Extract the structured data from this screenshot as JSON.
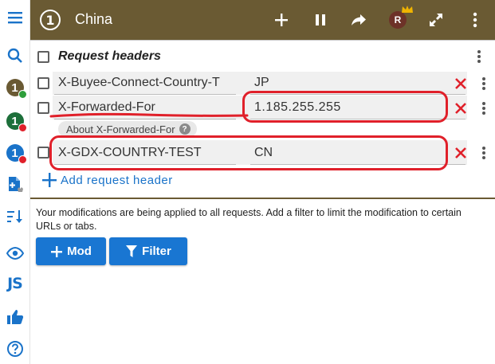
{
  "topbar": {
    "profile_number": "1",
    "profile_name": "China",
    "avatar_letter": "R"
  },
  "rail": {
    "profiles": [
      {
        "number": "1",
        "color": "#6a5a33",
        "badge": "#2e9e3b"
      },
      {
        "number": "1",
        "color": "#1d6f3a",
        "badge": "#e0202a"
      },
      {
        "number": "1",
        "color": "#1a73c9",
        "badge": "#e0202a"
      }
    ],
    "js_label": "JS"
  },
  "section": {
    "title": "Request headers"
  },
  "headers": [
    {
      "name": "X-Buyee-Connect-Country-T",
      "value": "JP"
    },
    {
      "name": "X-Forwarded-For",
      "value": "1.185.255.255"
    },
    {
      "name": "X-GDX-COUNTRY-TEST",
      "value": "CN"
    }
  ],
  "about_chip": "About X-Forwarded-For",
  "add_label": "Add request header",
  "info_text": "Your modifications are being applied to all requests. Add a filter to limit the modification to certain URLs or tabs.",
  "buttons": {
    "mod": "Mod",
    "filter": "Filter"
  },
  "colors": {
    "topbar": "#6a5a33",
    "primary": "#1976d2",
    "delete": "#e0202a",
    "annotation": "#e0202a"
  }
}
